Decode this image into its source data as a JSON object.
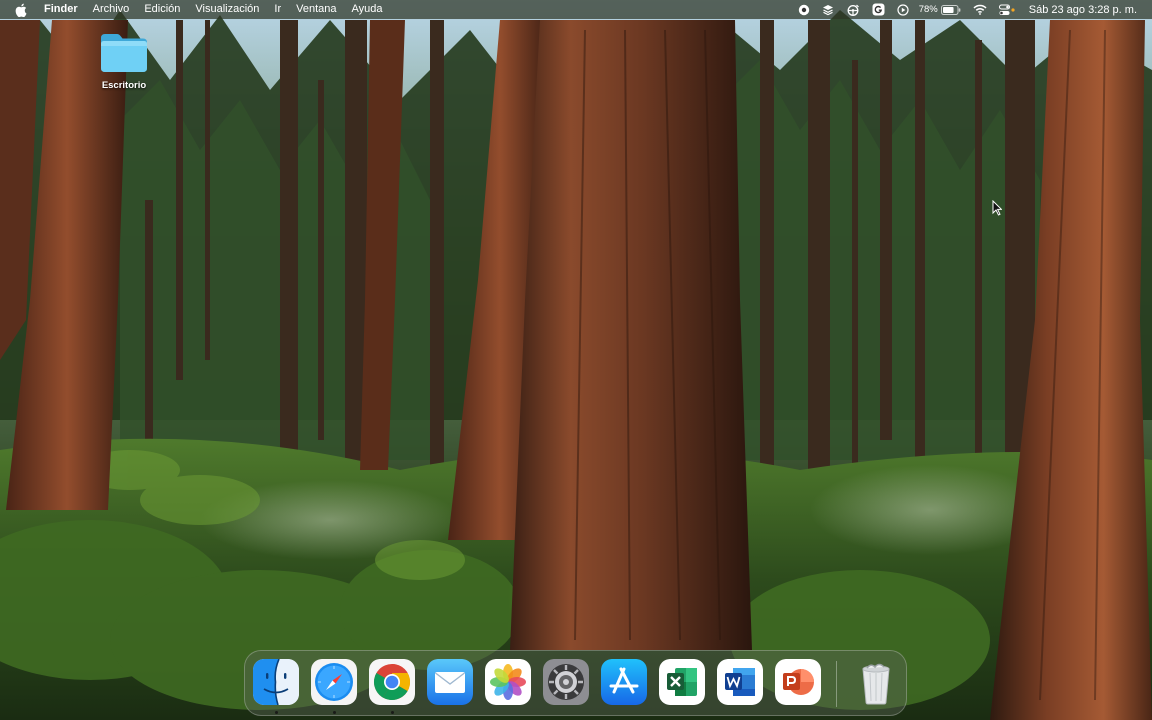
{
  "menubar": {
    "apple_icon": "apple-logo-icon",
    "app_name": "Finder",
    "menus": [
      "Archivo",
      "Edición",
      "Visualización",
      "Ir",
      "Ventana",
      "Ayuda"
    ],
    "status_icons": [
      "screen-record-icon",
      "layers-icon",
      "steering-wheel-icon",
      "grammarly-icon",
      "play-circle-icon",
      "battery-icon",
      "wifi-icon",
      "control-center-icon"
    ],
    "battery_percent": "78%",
    "battery_level": 0.78,
    "clock": "Sáb 23 ago  3:28 p. m."
  },
  "desktop": {
    "folder_label": "Escritorio",
    "folder_icon": "folder-icon"
  },
  "dock": {
    "apps": [
      {
        "name": "Finder",
        "icon": "finder-icon",
        "running": true
      },
      {
        "name": "Safari",
        "icon": "safari-icon",
        "running": true
      },
      {
        "name": "Google Chrome",
        "icon": "chrome-icon",
        "running": true
      },
      {
        "name": "Mail",
        "icon": "mail-icon",
        "running": false
      },
      {
        "name": "Fotos",
        "icon": "photos-icon",
        "running": false
      },
      {
        "name": "Configuración del Sistema",
        "icon": "system-settings-icon",
        "running": false
      },
      {
        "name": "App Store",
        "icon": "app-store-icon",
        "running": false
      },
      {
        "name": "Microsoft Excel",
        "icon": "excel-icon",
        "running": false
      },
      {
        "name": "Microsoft Word",
        "icon": "word-icon",
        "running": false
      },
      {
        "name": "Microsoft PowerPoint",
        "icon": "powerpoint-icon",
        "running": false
      },
      {
        "name": "Papelera",
        "icon": "trash-icon",
        "running": false
      }
    ]
  },
  "colors": {
    "folder_blue": "#5ec8f2",
    "excel_green": "#1f7a44",
    "word_blue": "#1f5fbf",
    "powerpoint_red": "#d24726",
    "app_store_blue": "#1e8cf0"
  }
}
